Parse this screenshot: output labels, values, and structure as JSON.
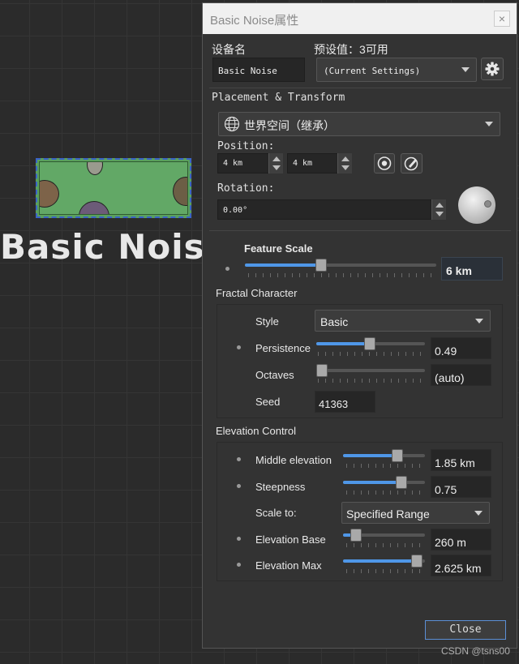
{
  "canvas": {
    "node_label": "Basic Noise"
  },
  "dialog": {
    "title": "Basic Noise属性",
    "close_x": "×",
    "device_name_label": "设备名",
    "preset_label": "预设值：3可用",
    "device_name_value": "Basic Noise",
    "preset_value": "(Current Settings)",
    "placement_header": "Placement & Transform",
    "space_value": "世界空间（继承）",
    "position_label": "Position:",
    "position_x": "4 km",
    "position_y": "4 km",
    "rotation_label": "Rotation:",
    "rotation_value": "0.00°",
    "feature_scale_label": "Feature Scale",
    "feature_scale_value": "6 km",
    "feature_scale_fraction": 0.39,
    "fractal_header": "Fractal Character",
    "style_label": "Style",
    "style_value": "Basic",
    "persistence_label": "Persistence",
    "persistence_value": "0.49",
    "persistence_fraction": 0.49,
    "octaves_label": "Octaves",
    "octaves_value": "(auto)",
    "octaves_fraction": 0.0,
    "seed_label": "Seed",
    "seed_value": "41363",
    "elevation_header": "Elevation Control",
    "middle_label": "Middle elevation",
    "middle_value": "1.85 km",
    "middle_fraction": 0.69,
    "steepness_label": "Steepness",
    "steepness_value": "0.75",
    "steepness_fraction": 0.75,
    "scale_to_label": "Scale to:",
    "scale_to_value": "Specified Range",
    "base_label": "Elevation Base",
    "base_value": "260 m",
    "base_fraction": 0.1,
    "max_label": "Elevation Max",
    "max_value": "2.625 km",
    "max_fraction": 0.97,
    "close_button": "Close"
  },
  "watermark": "CSDN @tsns00"
}
